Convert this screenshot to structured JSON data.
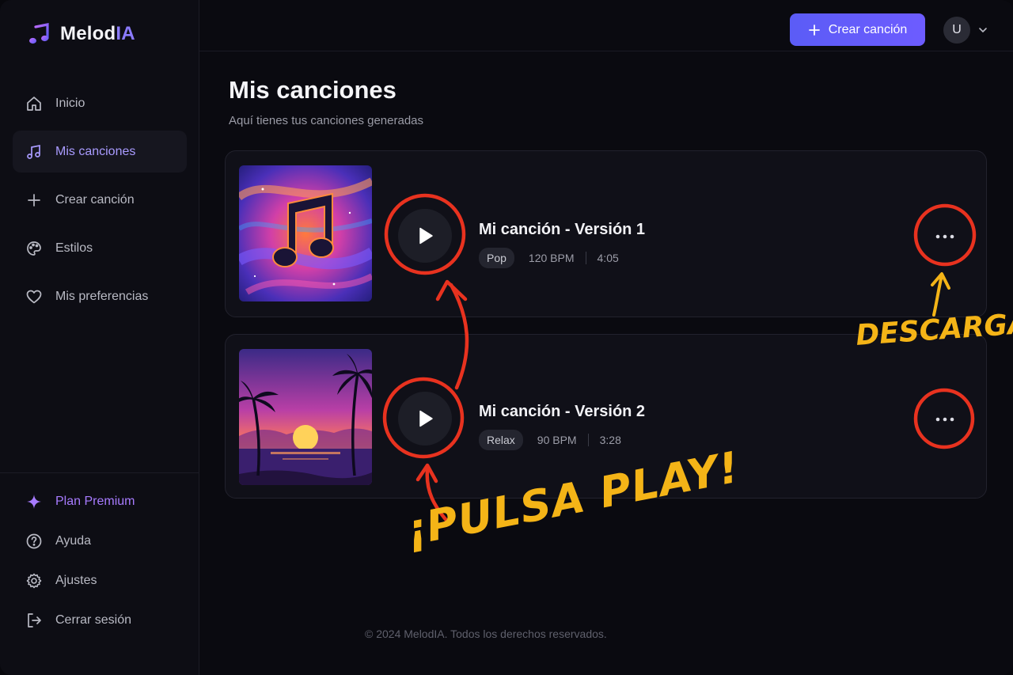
{
  "app": {
    "name_main": "Melod",
    "name_accent": "IA",
    "accent": "#8b7bff",
    "brand_gradient": [
      "#5b5cf6",
      "#6d5cff"
    ]
  },
  "sidebar": {
    "items": [
      {
        "label": "Inicio",
        "icon": "home-icon"
      },
      {
        "label": "Mis canciones",
        "icon": "music-note-icon",
        "active": true
      },
      {
        "label": "Crear canción",
        "icon": "plus-icon"
      },
      {
        "label": "Estilos",
        "icon": "palette-icon"
      },
      {
        "label": "Mis preferencias",
        "icon": "heart-icon"
      }
    ],
    "bottom": [
      {
        "label": "Plan Premium",
        "icon": "sparkle-icon"
      },
      {
        "label": "Ayuda",
        "icon": "help-circle-icon"
      },
      {
        "label": "Ajustes",
        "icon": "gear-icon"
      },
      {
        "label": "Cerrar sesión",
        "icon": "logout-icon"
      }
    ]
  },
  "header": {
    "create_label": "Crear canción",
    "avatar_initial": "U"
  },
  "main": {
    "title": "Mis canciones",
    "subtitle": "Aquí tienes tus canciones generadas",
    "songs": [
      {
        "title": "Mi canción - Versión 1",
        "genre": "Pop",
        "bpm": "120 BPM",
        "duration": "4:05",
        "cover": "music-note-cosmic"
      },
      {
        "title": "Mi canción - Versión 2",
        "genre": "Relax",
        "bpm": "90 BPM",
        "duration": "3:28",
        "cover": "sunset-palms"
      }
    ]
  },
  "footer": {
    "text": "© 2024 MelodIA. Todos los derechos reservados."
  },
  "annotations": {
    "download_label": "DESCARGAR",
    "play_label": "¡PULSA PLAY!",
    "color": "#f4b417",
    "circle_color": "#e8321f"
  }
}
